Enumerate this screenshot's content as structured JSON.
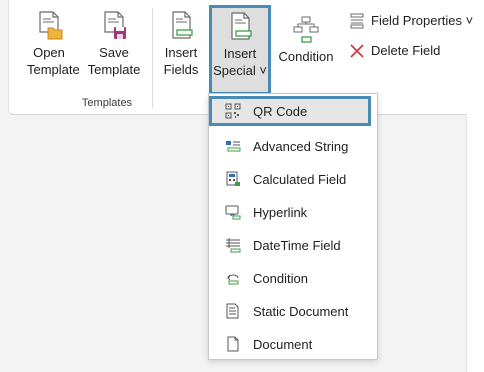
{
  "ribbon": {
    "open_template": "Open\nTemplate",
    "save_template": "Save\nTemplate",
    "group_label": "Templates",
    "insert_fields": "Insert\nFields",
    "insert_special": "Insert\nSpecial ˅",
    "condition": "Condition",
    "field_properties": "Field Properties ˅",
    "delete_field": "Delete Field"
  },
  "menu": {
    "items": [
      {
        "label": "QR Code",
        "icon": "qr-code-icon"
      },
      {
        "label": "Advanced String",
        "icon": "advanced-string-icon"
      },
      {
        "label": "Calculated Field",
        "icon": "calculator-icon"
      },
      {
        "label": "Hyperlink",
        "icon": "hyperlink-icon"
      },
      {
        "label": "DateTime Field",
        "icon": "datetime-icon"
      },
      {
        "label": "Condition",
        "icon": "condition-icon"
      },
      {
        "label": "Static Document",
        "icon": "static-document-icon"
      },
      {
        "label": "Document",
        "icon": "document-icon"
      }
    ]
  },
  "colors": {
    "accent_highlight": "#4a8bb5",
    "delete_red": "#d13438",
    "green": "#3f9d47",
    "folder_orange": "#f2b33d",
    "save_purple": "#9b3a7a"
  }
}
